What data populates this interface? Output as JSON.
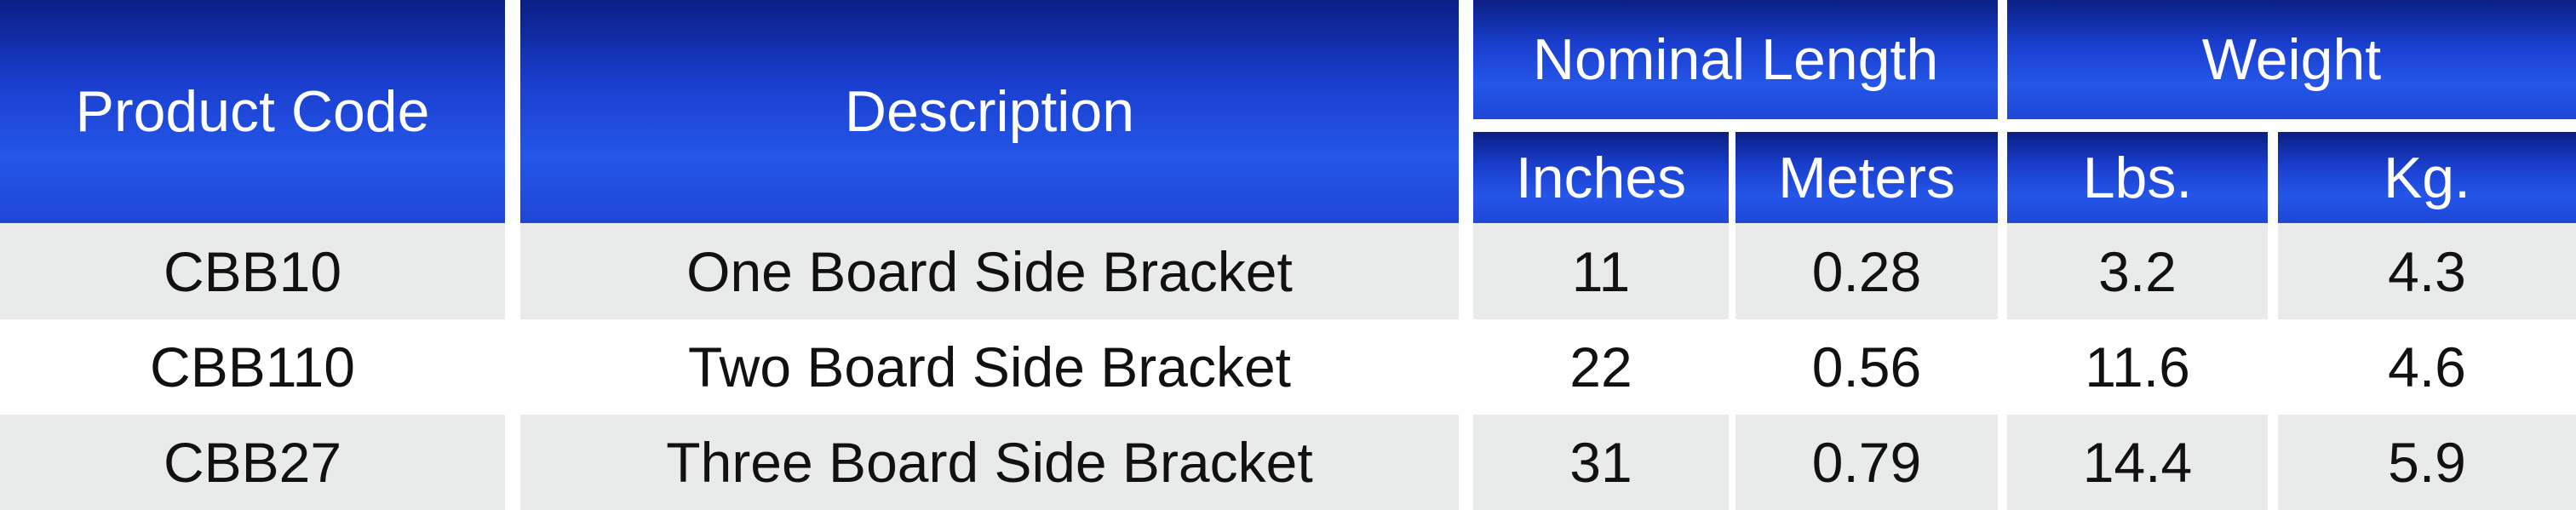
{
  "header": {
    "product_code": "Product Code",
    "description": "Description",
    "nominal_length": "Nominal Length",
    "weight": "Weight",
    "inches": "Inches",
    "meters": "Meters",
    "lbs": "Lbs.",
    "kg": "Kg."
  },
  "rows": [
    {
      "code": "CBB10",
      "description": "One Board Side Bracket",
      "inches": "11",
      "meters": "0.28",
      "lbs": "3.2",
      "kg": "4.3"
    },
    {
      "code": "CBB110",
      "description": "Two Board Side Bracket",
      "inches": "22",
      "meters": "0.56",
      "lbs": "11.6",
      "kg": "4.6"
    },
    {
      "code": "CBB27",
      "description": "Three Board Side Bracket",
      "inches": "31",
      "meters": "0.79",
      "lbs": "14.4",
      "kg": "5.9"
    }
  ],
  "colors": {
    "header_blue": "#1e47d6",
    "row_shade": "#e9ebeb",
    "text_dark": "#111111"
  }
}
